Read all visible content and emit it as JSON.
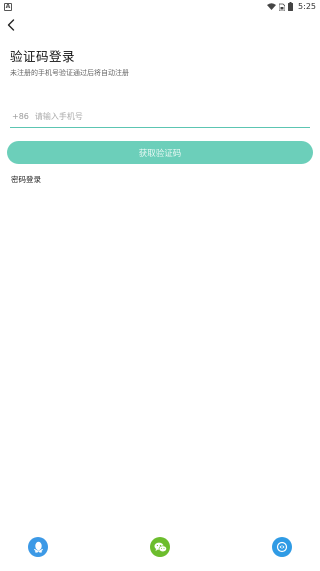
{
  "status_bar": {
    "notification_icon": "A",
    "time": "5:25"
  },
  "header": {
    "title": "验证码登录",
    "subtitle": "未注册的手机号验证通过后将自动注册"
  },
  "form": {
    "country_code": "+86",
    "phone_placeholder": "请输入手机号",
    "phone_value": "",
    "submit_label": "获取验证码"
  },
  "links": {
    "password_login": "密码登录"
  },
  "social_logins": [
    {
      "name": "qq-icon",
      "color": "#3c99e6"
    },
    {
      "name": "wechat-icon",
      "color": "#6cbd2d"
    },
    {
      "name": "weibo-icon",
      "color": "#2f9be5"
    }
  ],
  "colors": {
    "accent": "#6ccfba",
    "input_underline": "#5cc5b2"
  }
}
